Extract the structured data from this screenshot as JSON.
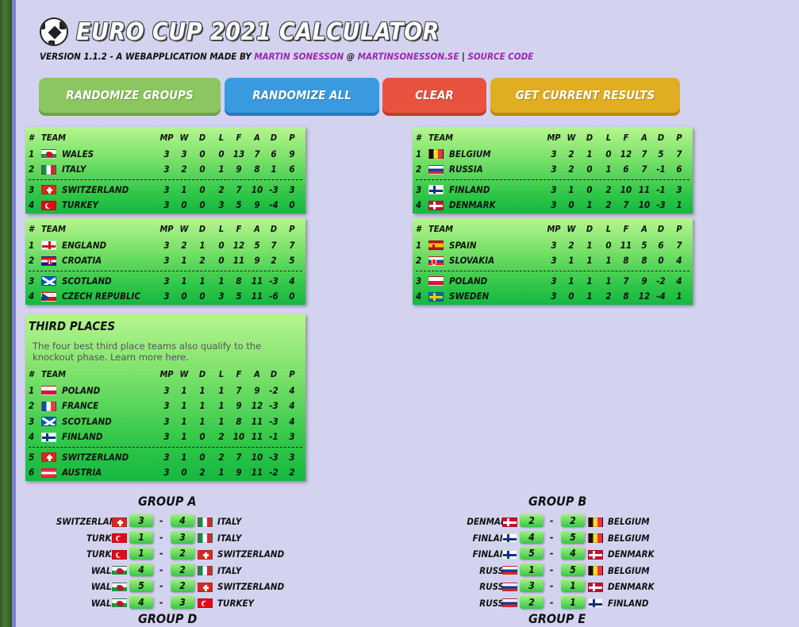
{
  "header": {
    "title": "EURO CUP 2021 CALCULATOR",
    "subtitle_prefix": "VERSION 1.1.2 - A WEBAPPLICATION MADE BY",
    "author_link": "MARTIN SONESSON",
    "at_sign": "@",
    "site_link": "MARTINSONESSON.SE",
    "divider": "|",
    "source_link": "SOURCE CODE"
  },
  "buttons": {
    "randomize_groups": "RANDOMIZE GROUPS",
    "randomize_all": "RANDOMIZE ALL",
    "clear": "CLEAR",
    "get_current": "GET CURRENT RESULTS"
  },
  "table_headers": {
    "num": "#",
    "team": "TEAM",
    "mp": "MP",
    "w": "W",
    "d": "D",
    "l": "L",
    "f": "F",
    "a": "A",
    "gd": "D",
    "p": "P"
  },
  "groups": [
    {
      "rows": [
        {
          "pos": "1",
          "flag": "wales",
          "team": "WALES",
          "mp": "3",
          "w": "3",
          "d": "0",
          "l": "0",
          "f": "13",
          "a": "7",
          "gd": "6",
          "p": "9"
        },
        {
          "pos": "2",
          "flag": "italy",
          "team": "ITALY",
          "mp": "3",
          "w": "2",
          "d": "0",
          "l": "1",
          "f": "9",
          "a": "8",
          "gd": "1",
          "p": "6"
        },
        {
          "pos": "3",
          "flag": "switzerland",
          "team": "SWITZERLAND",
          "mp": "3",
          "w": "1",
          "d": "0",
          "l": "2",
          "f": "7",
          "a": "10",
          "gd": "-3",
          "p": "3"
        },
        {
          "pos": "4",
          "flag": "turkey",
          "team": "TURKEY",
          "mp": "3",
          "w": "0",
          "d": "0",
          "l": "3",
          "f": "5",
          "a": "9",
          "gd": "-4",
          "p": "0"
        }
      ]
    },
    {
      "rows": [
        {
          "pos": "1",
          "flag": "belgium",
          "team": "BELGIUM",
          "mp": "3",
          "w": "2",
          "d": "1",
          "l": "0",
          "f": "12",
          "a": "7",
          "gd": "5",
          "p": "7"
        },
        {
          "pos": "2",
          "flag": "russia",
          "team": "RUSSIA",
          "mp": "3",
          "w": "2",
          "d": "0",
          "l": "1",
          "f": "6",
          "a": "7",
          "gd": "-1",
          "p": "6"
        },
        {
          "pos": "3",
          "flag": "finland",
          "team": "FINLAND",
          "mp": "3",
          "w": "1",
          "d": "0",
          "l": "2",
          "f": "10",
          "a": "11",
          "gd": "-1",
          "p": "3"
        },
        {
          "pos": "4",
          "flag": "denmark",
          "team": "DENMARK",
          "mp": "3",
          "w": "0",
          "d": "1",
          "l": "2",
          "f": "7",
          "a": "10",
          "gd": "-3",
          "p": "1"
        }
      ]
    },
    {
      "rows": [
        {
          "pos": "1",
          "flag": "england",
          "team": "ENGLAND",
          "mp": "3",
          "w": "2",
          "d": "1",
          "l": "0",
          "f": "12",
          "a": "5",
          "gd": "7",
          "p": "7"
        },
        {
          "pos": "2",
          "flag": "croatia",
          "team": "CROATIA",
          "mp": "3",
          "w": "1",
          "d": "2",
          "l": "0",
          "f": "11",
          "a": "9",
          "gd": "2",
          "p": "5"
        },
        {
          "pos": "3",
          "flag": "scotland",
          "team": "SCOTLAND",
          "mp": "3",
          "w": "1",
          "d": "1",
          "l": "1",
          "f": "8",
          "a": "11",
          "gd": "-3",
          "p": "4"
        },
        {
          "pos": "4",
          "flag": "czech",
          "team": "CZECH REPUBLIC",
          "mp": "3",
          "w": "0",
          "d": "0",
          "l": "3",
          "f": "5",
          "a": "11",
          "gd": "-6",
          "p": "0"
        }
      ]
    },
    {
      "rows": [
        {
          "pos": "1",
          "flag": "spain",
          "team": "SPAIN",
          "mp": "3",
          "w": "2",
          "d": "1",
          "l": "0",
          "f": "11",
          "a": "5",
          "gd": "6",
          "p": "7"
        },
        {
          "pos": "2",
          "flag": "slovakia",
          "team": "SLOVAKIA",
          "mp": "3",
          "w": "1",
          "d": "1",
          "l": "1",
          "f": "8",
          "a": "8",
          "gd": "0",
          "p": "4"
        },
        {
          "pos": "3",
          "flag": "poland",
          "team": "POLAND",
          "mp": "3",
          "w": "1",
          "d": "1",
          "l": "1",
          "f": "7",
          "a": "9",
          "gd": "-2",
          "p": "4"
        },
        {
          "pos": "4",
          "flag": "sweden",
          "team": "SWEDEN",
          "mp": "3",
          "w": "0",
          "d": "1",
          "l": "2",
          "f": "8",
          "a": "12",
          "gd": "-4",
          "p": "1"
        }
      ]
    }
  ],
  "third_places": {
    "title": "THIRD PLACES",
    "description": "The four best third place teams also qualify to the knockout phase. Learn more",
    "link": "here",
    "period": ".",
    "rows": [
      {
        "pos": "1",
        "flag": "poland",
        "team": "POLAND",
        "mp": "3",
        "w": "1",
        "d": "1",
        "l": "1",
        "f": "7",
        "a": "9",
        "gd": "-2",
        "p": "4"
      },
      {
        "pos": "2",
        "flag": "france",
        "team": "FRANCE",
        "mp": "3",
        "w": "1",
        "d": "1",
        "l": "1",
        "f": "9",
        "a": "12",
        "gd": "-3",
        "p": "4"
      },
      {
        "pos": "3",
        "flag": "scotland",
        "team": "SCOTLAND",
        "mp": "3",
        "w": "1",
        "d": "1",
        "l": "1",
        "f": "8",
        "a": "11",
        "gd": "-3",
        "p": "4"
      },
      {
        "pos": "4",
        "flag": "finland",
        "team": "FINLAND",
        "mp": "3",
        "w": "1",
        "d": "0",
        "l": "2",
        "f": "10",
        "a": "11",
        "gd": "-1",
        "p": "3"
      },
      {
        "pos": "5",
        "flag": "switzerland",
        "team": "SWITZERLAND",
        "mp": "3",
        "w": "1",
        "d": "0",
        "l": "2",
        "f": "7",
        "a": "10",
        "gd": "-3",
        "p": "3"
      },
      {
        "pos": "6",
        "flag": "austria",
        "team": "AUSTRIA",
        "mp": "3",
        "w": "0",
        "d": "2",
        "l": "1",
        "f": "9",
        "a": "11",
        "gd": "-2",
        "p": "2"
      }
    ]
  },
  "fixtures": {
    "group_a": {
      "title": "GROUP A",
      "matches": [
        {
          "home": "SWITZERLAND",
          "home_flag": "switzerland",
          "home_score": "3",
          "away_score": "4",
          "away": "ITALY",
          "away_flag": "italy"
        },
        {
          "home": "TURKEY",
          "home_flag": "turkey",
          "home_score": "1",
          "away_score": "3",
          "away": "ITALY",
          "away_flag": "italy"
        },
        {
          "home": "TURKEY",
          "home_flag": "turkey",
          "home_score": "1",
          "away_score": "2",
          "away": "SWITZERLAND",
          "away_flag": "switzerland"
        },
        {
          "home": "WALES",
          "home_flag": "wales",
          "home_score": "4",
          "away_score": "2",
          "away": "ITALY",
          "away_flag": "italy"
        },
        {
          "home": "WALES",
          "home_flag": "wales",
          "home_score": "5",
          "away_score": "2",
          "away": "SWITZERLAND",
          "away_flag": "switzerland"
        },
        {
          "home": "WALES",
          "home_flag": "wales",
          "home_score": "4",
          "away_score": "3",
          "away": "TURKEY",
          "away_flag": "turkey"
        }
      ]
    },
    "group_b": {
      "title": "GROUP B",
      "matches": [
        {
          "home": "DENMARK",
          "home_flag": "denmark",
          "home_score": "2",
          "away_score": "2",
          "away": "BELGIUM",
          "away_flag": "belgium"
        },
        {
          "home": "FINLAND",
          "home_flag": "finland",
          "home_score": "4",
          "away_score": "5",
          "away": "BELGIUM",
          "away_flag": "belgium"
        },
        {
          "home": "FINLAND",
          "home_flag": "finland",
          "home_score": "5",
          "away_score": "4",
          "away": "DENMARK",
          "away_flag": "denmark"
        },
        {
          "home": "RUSSIA",
          "home_flag": "russia",
          "home_score": "1",
          "away_score": "5",
          "away": "BELGIUM",
          "away_flag": "belgium"
        },
        {
          "home": "RUSSIA",
          "home_flag": "russia",
          "home_score": "3",
          "away_score": "1",
          "away": "DENMARK",
          "away_flag": "denmark"
        },
        {
          "home": "RUSSIA",
          "home_flag": "russia",
          "home_score": "2",
          "away_score": "1",
          "away": "FINLAND",
          "away_flag": "finland"
        }
      ]
    },
    "group_d_title": "GROUP D",
    "group_e_title": "GROUP E",
    "dash": "-"
  }
}
